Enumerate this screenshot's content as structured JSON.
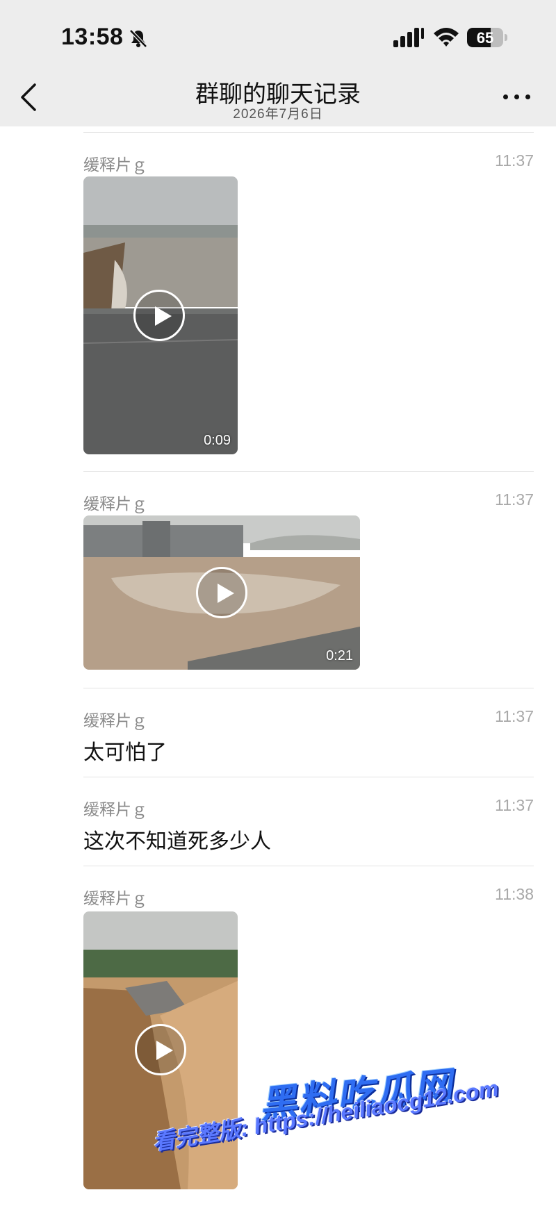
{
  "status_bar": {
    "time": "13:58",
    "battery": "65",
    "battery_level": 0.65
  },
  "header": {
    "title": "群聊的聊天记录",
    "date": "2026年7月6日"
  },
  "messages": [
    {
      "sender": "缓释片ｇ",
      "time": "11:37",
      "type": "video",
      "duration": "0:09"
    },
    {
      "sender": "缓释片ｇ",
      "time": "11:37",
      "type": "video",
      "duration": "0:21"
    },
    {
      "sender": "缓释片ｇ",
      "time": "11:37",
      "type": "text",
      "text": "太可怕了"
    },
    {
      "sender": "缓释片ｇ",
      "time": "11:37",
      "type": "text",
      "text": "这次不知道死多少人"
    },
    {
      "sender": "缓释片ｇ",
      "time": "11:38",
      "type": "video"
    }
  ],
  "watermark": {
    "brand": "黑料吃瓜网",
    "line": "看完整版: https://heiliaocg12.com"
  },
  "colors": {
    "header_bg": "#ededed",
    "watermark_blue": "#2f6df2"
  }
}
